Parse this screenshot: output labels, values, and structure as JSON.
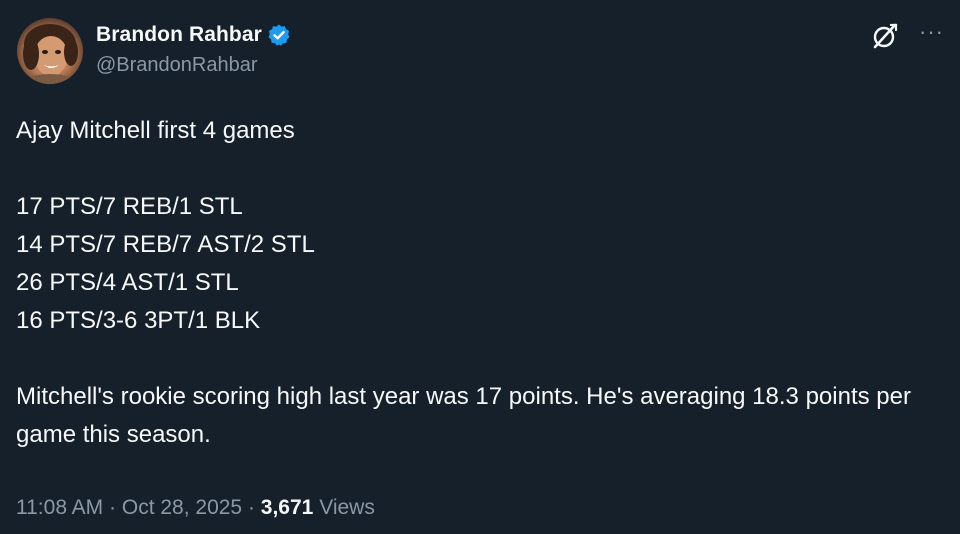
{
  "author": {
    "display_name": "Brandon Rahbar",
    "handle": "@BrandonRahbar",
    "verified": true
  },
  "colors": {
    "background": "#15202b",
    "text_primary": "#f7f9f9",
    "text_secondary": "#8b98a5",
    "verified_blue": "#1d9bf0"
  },
  "icons": [
    "avatar",
    "verified-badge-icon",
    "grok-icon",
    "more-options-icon"
  ],
  "tweet": {
    "intro": "Ajay Mitchell first 4 games",
    "stat_lines": [
      "17 PTS/7 REB/1 STL",
      "14 PTS/7 REB/7 AST/2 STL",
      "26 PTS/4 AST/1 STL",
      "16 PTS/3-6 3PT/1 BLK"
    ],
    "closing": "Mitchell's rookie scoring high last year was 17 points. He's averaging 18.3 points per game this season."
  },
  "meta": {
    "time": "11:08 AM",
    "separator": "·",
    "date": "Oct 28, 2025",
    "views_count": "3,671",
    "views_label": "Views"
  },
  "more_options": "···"
}
